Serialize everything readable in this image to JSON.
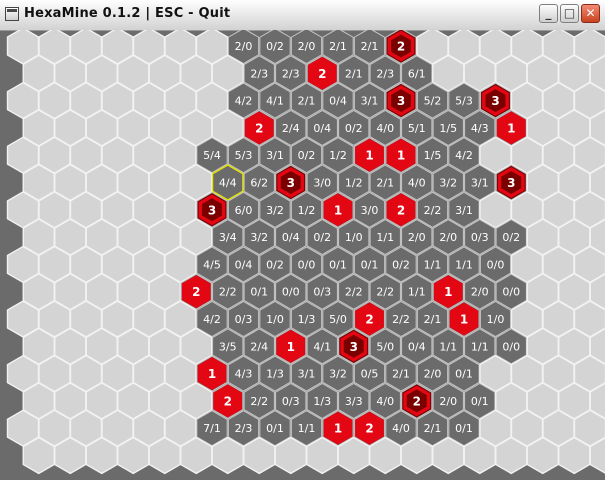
{
  "window": {
    "title": "HexaMine 0.1.2 | ESC - Quit",
    "buttons": {
      "minimize": "_",
      "maximize": "□",
      "close": "✕"
    }
  },
  "colors": {
    "background": "#6b6b6b",
    "hidden_cell": "#d4d4d4",
    "revealed_cell": "#6b6b6b",
    "revealed_border": "#c8c8c8",
    "flag_red": "#e30613",
    "dark_red": "#7a0000",
    "cursor": "#e6e600"
  },
  "board": {
    "rows": [
      [
        {
          "c": 7,
          "v": "2/0"
        },
        {
          "c": 8,
          "v": "0/2"
        },
        {
          "c": 9,
          "v": "2/0"
        },
        {
          "c": 10,
          "v": "2/1"
        },
        {
          "c": 11,
          "v": "2/1"
        },
        {
          "c": 12,
          "v": "2",
          "t": "mineX"
        }
      ],
      [
        {
          "c": 7,
          "v": "2/3"
        },
        {
          "c": 8,
          "v": "2/3"
        },
        {
          "c": 9,
          "v": "2",
          "t": "mine"
        },
        {
          "c": 10,
          "v": "2/1"
        },
        {
          "c": 11,
          "v": "2/3"
        },
        {
          "c": 12,
          "v": "6/1"
        }
      ],
      [
        {
          "c": 7,
          "v": "4/2"
        },
        {
          "c": 8,
          "v": "4/1"
        },
        {
          "c": 9,
          "v": "2/1"
        },
        {
          "c": 10,
          "v": "0/4"
        },
        {
          "c": 11,
          "v": "3/1"
        },
        {
          "c": 12,
          "v": "3",
          "t": "mineX"
        },
        {
          "c": 13,
          "v": "5/2"
        },
        {
          "c": 14,
          "v": "5/3"
        },
        {
          "c": 15,
          "v": "3",
          "t": "mineX"
        }
      ],
      [
        {
          "c": 7,
          "v": "2",
          "t": "mine"
        },
        {
          "c": 8,
          "v": "2/4"
        },
        {
          "c": 9,
          "v": "0/4"
        },
        {
          "c": 10,
          "v": "0/2"
        },
        {
          "c": 11,
          "v": "4/0"
        },
        {
          "c": 12,
          "v": "5/1"
        },
        {
          "c": 13,
          "v": "1/5"
        },
        {
          "c": 14,
          "v": "4/3"
        },
        {
          "c": 15,
          "v": "1",
          "t": "mine"
        }
      ],
      [
        {
          "c": 6,
          "v": "5/4"
        },
        {
          "c": 7,
          "v": "5/3"
        },
        {
          "c": 8,
          "v": "3/1"
        },
        {
          "c": 9,
          "v": "0/2"
        },
        {
          "c": 10,
          "v": "1/2"
        },
        {
          "c": 11,
          "v": "1",
          "t": "mine"
        },
        {
          "c": 12,
          "v": "1",
          "t": "mine"
        },
        {
          "c": 13,
          "v": "1/5"
        },
        {
          "c": 14,
          "v": "4/2"
        }
      ],
      [
        {
          "c": 6,
          "v": "4/4",
          "t": "cursor"
        },
        {
          "c": 7,
          "v": "6/2"
        },
        {
          "c": 8,
          "v": "3",
          "t": "mineX"
        },
        {
          "c": 9,
          "v": "3/0"
        },
        {
          "c": 10,
          "v": "1/2"
        },
        {
          "c": 11,
          "v": "2/1"
        },
        {
          "c": 12,
          "v": "4/0"
        },
        {
          "c": 13,
          "v": "3/2"
        },
        {
          "c": 14,
          "v": "3/1"
        },
        {
          "c": 15,
          "v": "3",
          "t": "mineX"
        }
      ],
      [
        {
          "c": 6,
          "v": "3",
          "t": "mineX"
        },
        {
          "c": 7,
          "v": "6/0"
        },
        {
          "c": 8,
          "v": "3/2"
        },
        {
          "c": 9,
          "v": "1/2"
        },
        {
          "c": 10,
          "v": "1",
          "t": "mine"
        },
        {
          "c": 11,
          "v": "3/0"
        },
        {
          "c": 12,
          "v": "2",
          "t": "mine"
        },
        {
          "c": 13,
          "v": "2/2"
        },
        {
          "c": 14,
          "v": "3/1"
        }
      ],
      [
        {
          "c": 6,
          "v": "3/4"
        },
        {
          "c": 7,
          "v": "3/2"
        },
        {
          "c": 8,
          "v": "0/4"
        },
        {
          "c": 9,
          "v": "0/2"
        },
        {
          "c": 10,
          "v": "1/0"
        },
        {
          "c": 11,
          "v": "1/1"
        },
        {
          "c": 12,
          "v": "2/0"
        },
        {
          "c": 13,
          "v": "2/0"
        },
        {
          "c": 14,
          "v": "0/3"
        },
        {
          "c": 15,
          "v": "0/2"
        }
      ],
      [
        {
          "c": 6,
          "v": "4/5"
        },
        {
          "c": 7,
          "v": "0/4"
        },
        {
          "c": 8,
          "v": "0/2"
        },
        {
          "c": 9,
          "v": "0/0"
        },
        {
          "c": 10,
          "v": "0/1"
        },
        {
          "c": 11,
          "v": "0/1"
        },
        {
          "c": 12,
          "v": "0/2"
        },
        {
          "c": 13,
          "v": "1/1"
        },
        {
          "c": 14,
          "v": "1/1"
        },
        {
          "c": 15,
          "v": "0/0"
        }
      ],
      [
        {
          "c": 5,
          "v": "2",
          "t": "mine"
        },
        {
          "c": 6,
          "v": "2/2"
        },
        {
          "c": 7,
          "v": "0/1"
        },
        {
          "c": 8,
          "v": "0/0"
        },
        {
          "c": 9,
          "v": "0/3"
        },
        {
          "c": 10,
          "v": "2/2"
        },
        {
          "c": 11,
          "v": "2/2"
        },
        {
          "c": 12,
          "v": "1/1"
        },
        {
          "c": 13,
          "v": "1",
          "t": "mine"
        },
        {
          "c": 14,
          "v": "2/0"
        },
        {
          "c": 15,
          "v": "0/0"
        }
      ],
      [
        {
          "c": 6,
          "v": "4/2"
        },
        {
          "c": 7,
          "v": "0/3"
        },
        {
          "c": 8,
          "v": "1/0"
        },
        {
          "c": 9,
          "v": "1/3"
        },
        {
          "c": 10,
          "v": "5/0"
        },
        {
          "c": 11,
          "v": "2",
          "t": "mine"
        },
        {
          "c": 12,
          "v": "2/2"
        },
        {
          "c": 13,
          "v": "2/1"
        },
        {
          "c": 14,
          "v": "1",
          "t": "mine"
        },
        {
          "c": 15,
          "v": "1/0"
        }
      ],
      [
        {
          "c": 6,
          "v": "3/5"
        },
        {
          "c": 7,
          "v": "2/4"
        },
        {
          "c": 8,
          "v": "1",
          "t": "mine"
        },
        {
          "c": 9,
          "v": "4/1"
        },
        {
          "c": 10,
          "v": "3",
          "t": "mineX"
        },
        {
          "c": 11,
          "v": "5/0"
        },
        {
          "c": 12,
          "v": "0/4"
        },
        {
          "c": 13,
          "v": "1/1"
        },
        {
          "c": 14,
          "v": "1/1"
        },
        {
          "c": 15,
          "v": "0/0"
        }
      ],
      [
        {
          "c": 6,
          "v": "1",
          "t": "mine"
        },
        {
          "c": 7,
          "v": "4/3"
        },
        {
          "c": 8,
          "v": "1/3"
        },
        {
          "c": 9,
          "v": "3/1"
        },
        {
          "c": 10,
          "v": "3/2"
        },
        {
          "c": 11,
          "v": "0/5"
        },
        {
          "c": 12,
          "v": "2/1"
        },
        {
          "c": 13,
          "v": "2/0"
        },
        {
          "c": 14,
          "v": "0/1"
        }
      ],
      [
        {
          "c": 6,
          "v": "2",
          "t": "mine"
        },
        {
          "c": 7,
          "v": "2/2"
        },
        {
          "c": 8,
          "v": "0/3"
        },
        {
          "c": 9,
          "v": "1/3"
        },
        {
          "c": 10,
          "v": "3/3"
        },
        {
          "c": 11,
          "v": "4/0"
        },
        {
          "c": 12,
          "v": "2",
          "t": "mineX"
        },
        {
          "c": 13,
          "v": "2/0"
        },
        {
          "c": 14,
          "v": "0/1"
        }
      ],
      [
        {
          "c": 6,
          "v": "7/1"
        },
        {
          "c": 7,
          "v": "2/3"
        },
        {
          "c": 8,
          "v": "0/1"
        },
        {
          "c": 9,
          "v": "1/1"
        },
        {
          "c": 10,
          "v": "1",
          "t": "mine"
        },
        {
          "c": 11,
          "v": "2",
          "t": "mine"
        },
        {
          "c": 12,
          "v": "4/0"
        },
        {
          "c": 13,
          "v": "2/1"
        },
        {
          "c": 14,
          "v": "0/1"
        }
      ]
    ]
  }
}
